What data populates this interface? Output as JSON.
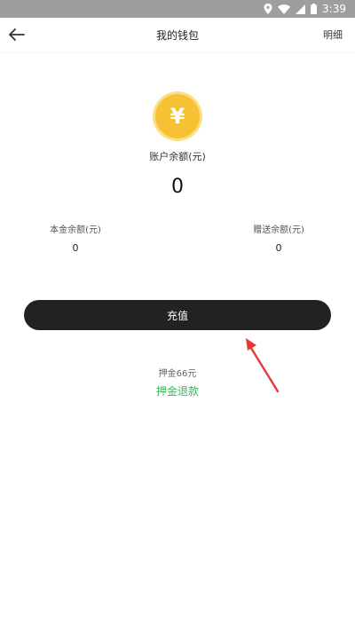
{
  "status_bar": {
    "time": "3:39"
  },
  "header": {
    "title": "我的钱包",
    "detail_label": "明细"
  },
  "wallet": {
    "currency_symbol": "¥",
    "balance_label": "账户余额(元)",
    "balance_value": "0",
    "principal_label": "本金余额(元)",
    "principal_value": "0",
    "gift_label": "赠送余额(元)",
    "gift_value": "0"
  },
  "actions": {
    "recharge_label": "充值",
    "deposit_text": "押金66元",
    "refund_label": "押金退款"
  },
  "colors": {
    "accent_green": "#27c24c",
    "coin_gold": "#f6c234",
    "button_dark": "#222222",
    "annotation_red": "#e53935"
  }
}
